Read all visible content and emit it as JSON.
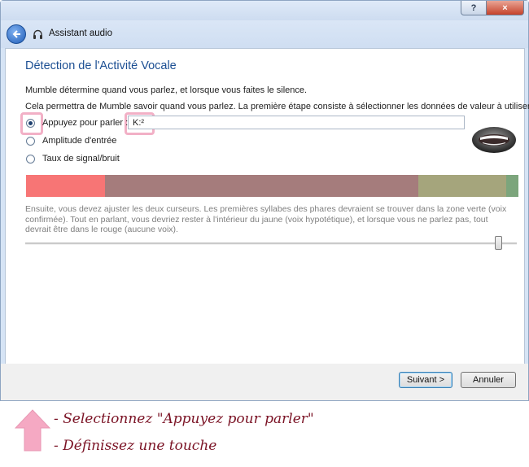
{
  "window": {
    "help_label": "?",
    "close_label": "×",
    "title": "Assistant audio"
  },
  "page": {
    "title": "Détection de l'Activité Vocale",
    "line1": "Mumble détermine quand vous parlez, et lorsque vous faites le silence.",
    "line2": "Cela permettra de Mumble savoir quand vous parlez. La première étape consiste à sélectionner les données de valeur à utiliser."
  },
  "options": {
    "push_to_talk": "Appuyez pour parler :",
    "key_value": "K:²",
    "amplitude": "Amplitude d'entrée",
    "snr": "Taux de signal/bruit",
    "selected": "push_to_talk"
  },
  "hint": "Ensuite, vous devez ajuster les deux curseurs. Les premières syllabes des phares devraient se trouver dans la zone verte (voix confirmée). Tout en parlant, vous devriez rester à l'intérieur du jaune (voix hypotétique), et lorsque vous ne parlez pas, tout devrait être dans le rouge (aucune voix).",
  "meter": {
    "colors": [
      "#f77575",
      "#a57c7c",
      "#a5a57c",
      "#7ca57c"
    ]
  },
  "slider": {
    "value": 0.97
  },
  "buttons": {
    "next": "Suivant >",
    "cancel": "Annuler"
  },
  "annotations": {
    "step1": "- Selectionnez \"Appuyez pour parler\"",
    "step2": "- Définissez une touche"
  },
  "colors": {
    "highlight": "#f2b0c6",
    "annotation_text": "#7b1325",
    "title_blue": "#1c4f93"
  }
}
